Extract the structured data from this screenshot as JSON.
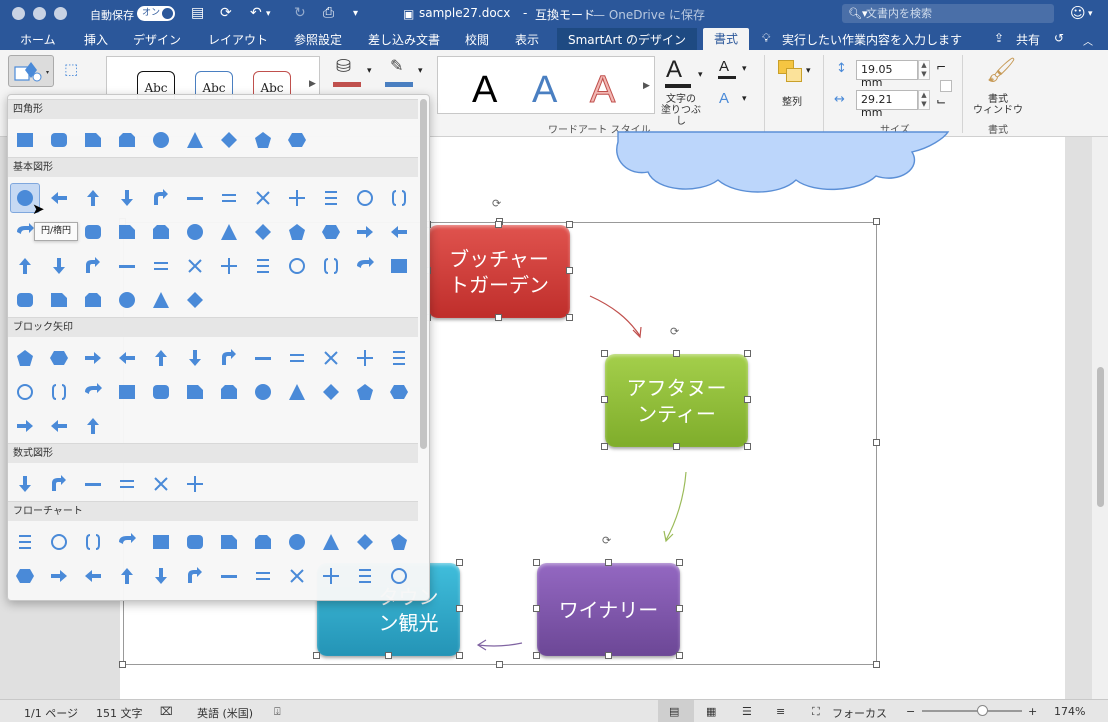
{
  "title_bar": {
    "autosave_label": "自動保存",
    "autosave_state": "オン",
    "document_title": "sample27.docx",
    "mode": "互換モード",
    "cloud": "— OneDrive に保存",
    "search_placeholder": "文書内を検索"
  },
  "tabs": [
    {
      "label": "ホーム"
    },
    {
      "label": "挿入"
    },
    {
      "label": "デザイン"
    },
    {
      "label": "レイアウト"
    },
    {
      "label": "参照設定"
    },
    {
      "label": "差し込み文書"
    },
    {
      "label": "校閲"
    },
    {
      "label": "表示"
    },
    {
      "label": "SmartArt のデザイン"
    },
    {
      "label": "書式"
    }
  ],
  "tell_me": "実行したい作業内容を入力します",
  "share_label": "共有",
  "ribbon": {
    "shape_styles": [
      "Abc",
      "Abc",
      "Abc"
    ],
    "wordart_letters": [
      "A",
      "A",
      "A"
    ],
    "text_fill_label": "文字の\n塗りつぶし",
    "wordart_group_label": "ワードアート スタイル",
    "arrange_label": "整列",
    "height_value": "19.05 mm",
    "width_value": "29.21 mm",
    "size_group_label": "サイズ",
    "format_pane_label": "書式\nウィンドウ",
    "format_group_label": "書式"
  },
  "shapes_panel": {
    "categories": [
      {
        "label": "四角形",
        "count": 9
      },
      {
        "label": "基本図形",
        "count": 42
      },
      {
        "label": "ブロック矢印",
        "count": 27
      },
      {
        "label": "数式図形",
        "count": 6
      },
      {
        "label": "フローチャート",
        "count": 24
      }
    ],
    "tooltip": "円/楕円"
  },
  "diagram": {
    "nodes": [
      {
        "text": "ブッチャー\nトガーデン",
        "color": "#d33a36"
      },
      {
        "text": "アフタヌー\nンティー",
        "color": "#8fbf35"
      },
      {
        "text": "ワイナリー",
        "color": "#7d55a8"
      },
      {
        "text": "タウン\nン観光",
        "color": "#2ea8c8"
      }
    ],
    "arrow_colors": [
      "#c0504d",
      "#9bbb59",
      "#8064a2"
    ]
  },
  "status_bar": {
    "page": "1/1 ページ",
    "words": "151 文字",
    "language": "英語 (米国)",
    "focus": "フォーカス",
    "zoom_out": "−",
    "zoom_in": "+",
    "zoom": "174%",
    "zoom_fraction": 0.6
  },
  "colors": {
    "accent": "#2b579a",
    "shape_icon": "#4a8ad8"
  }
}
